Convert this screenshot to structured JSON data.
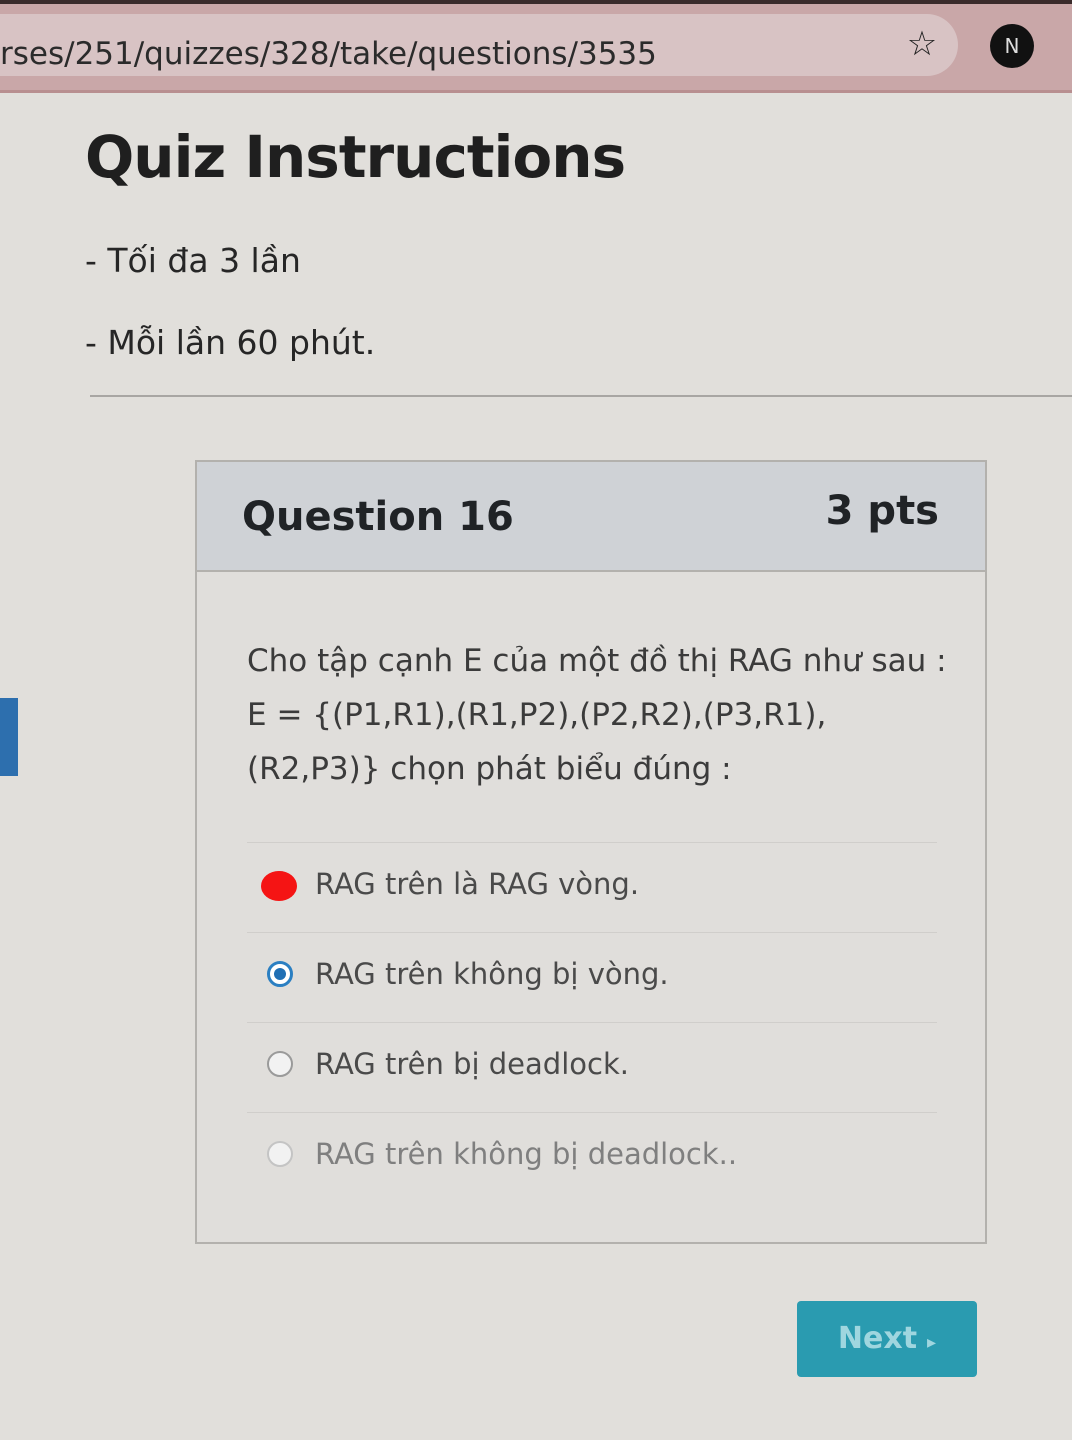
{
  "browser": {
    "url": "rses/251/quizzes/328/take/questions/3535",
    "profile_initial": "N"
  },
  "page": {
    "title": "Quiz Instructions",
    "instructions": [
      "- Tối đa 3 lần",
      "- Mỗi lần 60 phút."
    ]
  },
  "question": {
    "number_label": "Question 16",
    "points": "3 pts",
    "text": "Cho tập cạnh E của một đồ thị RAG như sau : E = {(P1,R1),(R1,P2),(P2,R2),(P3,R1),(R2,P3)} chọn phát biểu đúng :",
    "answers": [
      {
        "label": "RAG trên là RAG vòng.",
        "selected": false
      },
      {
        "label": "RAG trên không bị vòng.",
        "selected": true
      },
      {
        "label": "RAG trên bị deadlock.",
        "selected": false
      },
      {
        "label": "RAG trên không bị deadlock..",
        "selected": false
      }
    ]
  },
  "nav": {
    "next_label": "Next",
    "next_arrow": "▸"
  },
  "colors": {
    "accent": "#2b7fc2",
    "next_button": "#2a9bb0",
    "annotation_red": "#f51414"
  }
}
